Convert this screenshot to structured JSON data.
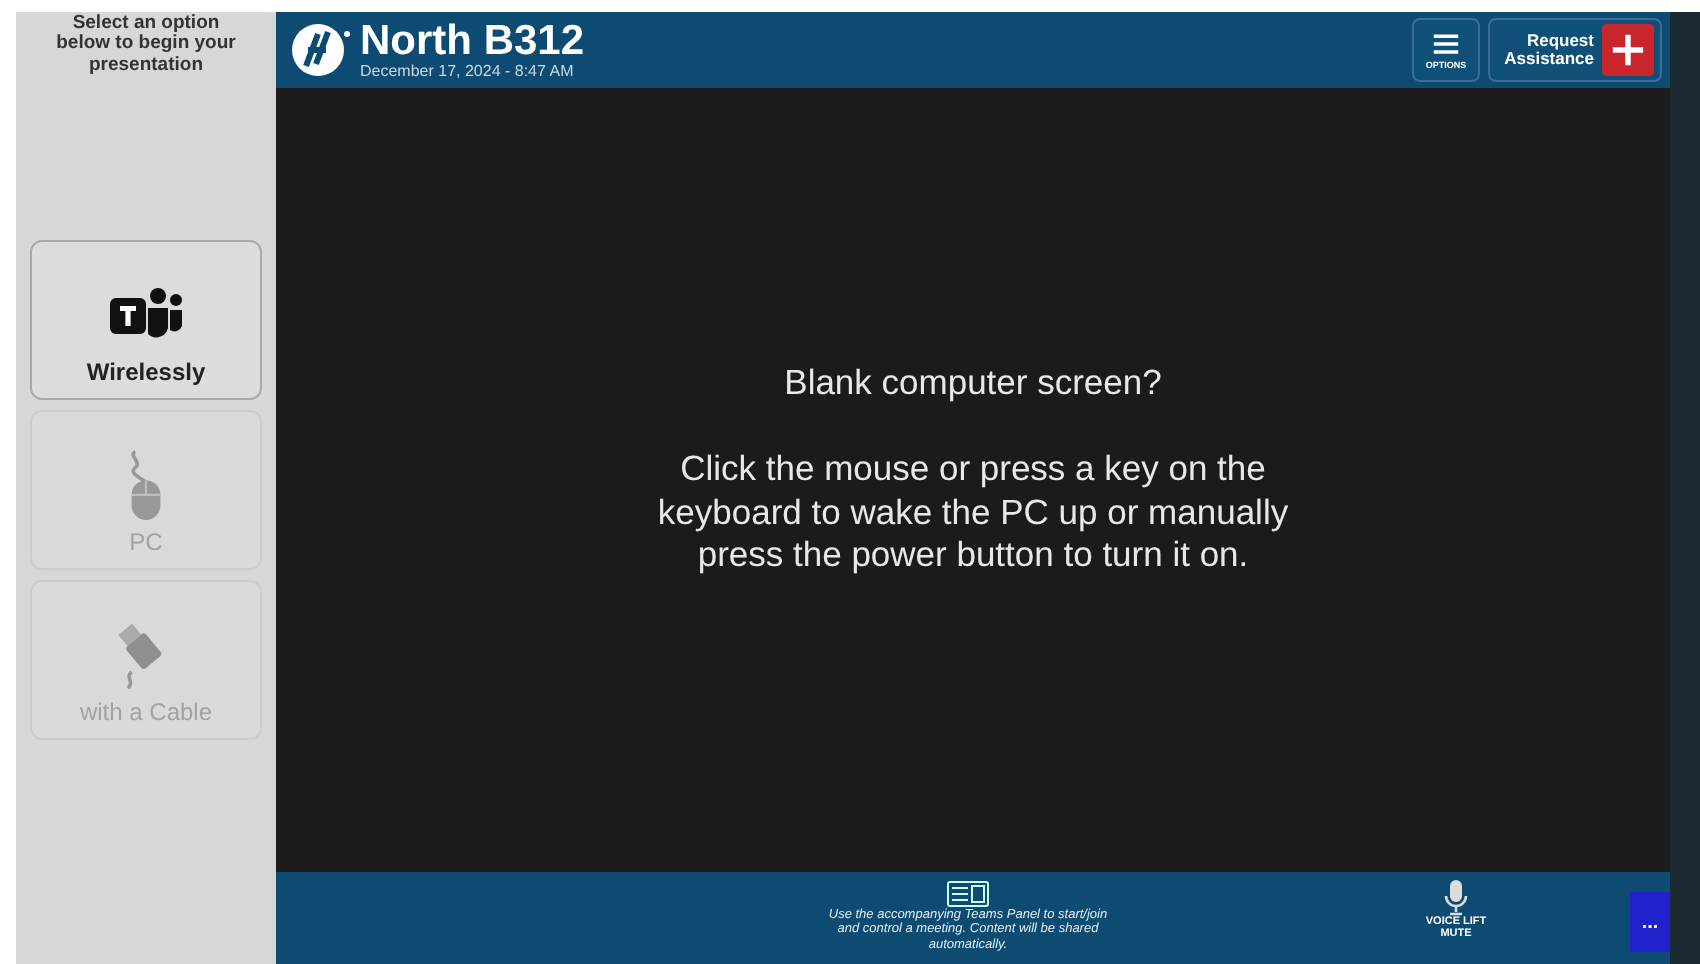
{
  "sidebar": {
    "prompt": "Select an option below to begin your presentation",
    "sources": [
      {
        "kind": "teams",
        "label": "Wirelessly",
        "disabled": false
      },
      {
        "kind": "mouse",
        "label": "PC",
        "disabled": true
      },
      {
        "kind": "cable",
        "label": "with a Cable",
        "disabled": true
      }
    ]
  },
  "header": {
    "room": "North B312",
    "datetime": "December 17, 2024 - 8:47 AM",
    "options_label": "OPTIONS",
    "assist_label": "Request Assistance"
  },
  "main": {
    "heading": "Blank computer screen?",
    "message": "Click the mouse or press a key on the keyboard to wake the PC up or manually press the power button to turn it on."
  },
  "footer": {
    "teams_note": "Use the accompanying Teams Panel to start/join and control a meeting. Content will be shared automatically.",
    "voice_label": "VOICE LIFT MUTE",
    "more_label": "..."
  }
}
